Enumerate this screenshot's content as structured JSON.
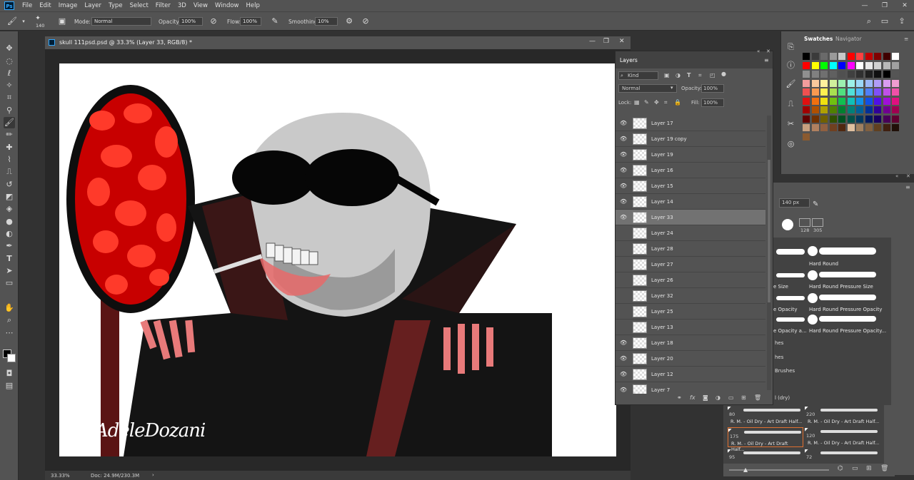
{
  "menu": {
    "logo": "Ps",
    "items": [
      "File",
      "Edit",
      "Image",
      "Layer",
      "Type",
      "Select",
      "Filter",
      "3D",
      "View",
      "Window",
      "Help"
    ]
  },
  "options": {
    "brush_size": "140",
    "mode_label": "Mode:",
    "mode_value": "Normal",
    "opacity_label": "Opacity:",
    "opacity_value": "100%",
    "flow_label": "Flow:",
    "flow_value": "100%",
    "smoothing_label": "Smoothing:",
    "smoothing_value": "10%"
  },
  "document": {
    "title": "skull 111psd.psd @ 33.3% (Layer 33, RGB/8) *",
    "zoom": "33.33%",
    "doc_size": "Doc: 24.9M/230.3M",
    "signature": "AdeleDozani"
  },
  "swatches": {
    "tab_active": "Swatches",
    "tab_other": "Navigator",
    "colors": [
      [
        "#000000",
        "#3a3a3a",
        "#6a6a6a",
        "#9a9a9a",
        "#c8c8c8",
        "#ff0000",
        "#ff4040",
        "#c00000",
        "#800000",
        "#400000",
        "#ffffff"
      ],
      [
        "#ff0000",
        "#ffff00",
        "#00ff00",
        "#00ffff",
        "#0000ff",
        "#ff00ff",
        "#ffffff",
        "#e8e8e8",
        "#d0d0d0",
        "#b8b8b8",
        "#a0a0a0"
      ],
      [
        "#909090",
        "#808080",
        "#707070",
        "#606060",
        "#505050",
        "#404040",
        "#303030",
        "#202020",
        "#101010",
        "#000000",
        "#555555"
      ],
      [
        "#f29c9c",
        "#f8c89c",
        "#fff09c",
        "#d0f09c",
        "#9cf0b0",
        "#9cf0e8",
        "#9cd8f8",
        "#9cb8f8",
        "#b09cf8",
        "#d89cf0",
        "#f09cd0"
      ],
      [
        "#ee5050",
        "#f89a50",
        "#fff050",
        "#a8e050",
        "#50e080",
        "#50e0d8",
        "#50b8f8",
        "#5080f8",
        "#8050f8",
        "#c050e8",
        "#f050a8"
      ],
      [
        "#e01010",
        "#f07010",
        "#f0e010",
        "#70c010",
        "#10c050",
        "#10c0b8",
        "#1090e8",
        "#1050e8",
        "#5010e8",
        "#a010d8",
        "#e01080"
      ],
      [
        "#a00000",
        "#b05000",
        "#b0a000",
        "#508000",
        "#008030",
        "#008078",
        "#006098",
        "#003098",
        "#300098",
        "#700090",
        "#a00050"
      ],
      [
        "#600000",
        "#703000",
        "#706000",
        "#305000",
        "#005020",
        "#005048",
        "#003860",
        "#001860",
        "#180060",
        "#480058",
        "#600030"
      ],
      [
        "#c8a080",
        "#b08060",
        "#906040",
        "#704020",
        "#502810",
        "#e0c0a0",
        "#a08060",
        "#806040",
        "#604020",
        "#402010",
        "#201008"
      ],
      [
        "#8a5a30"
      ]
    ]
  },
  "layers": {
    "panel_title": "Layers",
    "kind_label": "Kind",
    "blend_mode": "Normal",
    "opacity_label": "Opacity:",
    "opacity_value": "100%",
    "lock_label": "Lock:",
    "fill_label": "Fill:",
    "fill_value": "100%",
    "items": [
      {
        "name": "Layer 17",
        "visible": true,
        "selected": false
      },
      {
        "name": "Layer 19 copy",
        "visible": true,
        "selected": false
      },
      {
        "name": "Layer 19",
        "visible": true,
        "selected": false
      },
      {
        "name": "Layer 16",
        "visible": true,
        "selected": false
      },
      {
        "name": "Layer 15",
        "visible": true,
        "selected": false
      },
      {
        "name": "Layer 14",
        "visible": true,
        "selected": false
      },
      {
        "name": "Layer 33",
        "visible": true,
        "selected": true
      },
      {
        "name": "Layer 24",
        "visible": false,
        "selected": false
      },
      {
        "name": "Layer 28",
        "visible": false,
        "selected": false
      },
      {
        "name": "Layer 27",
        "visible": false,
        "selected": false
      },
      {
        "name": "Layer 26",
        "visible": false,
        "selected": false
      },
      {
        "name": "Layer 32",
        "visible": false,
        "selected": false
      },
      {
        "name": "Layer 25",
        "visible": false,
        "selected": false
      },
      {
        "name": "Layer 13",
        "visible": false,
        "selected": false
      },
      {
        "name": "Layer 18",
        "visible": true,
        "selected": false
      },
      {
        "name": "Layer 20",
        "visible": true,
        "selected": false
      },
      {
        "name": "Layer 12",
        "visible": true,
        "selected": false
      },
      {
        "name": "Layer 7",
        "visible": true,
        "selected": false
      }
    ]
  },
  "brushes": {
    "size": "140 px",
    "preset_values": [
      "128",
      "305"
    ],
    "list": [
      {
        "left": "",
        "right": "Hard Round"
      },
      {
        "left": "e Size",
        "right": "Hard Round Pressure Size"
      },
      {
        "left": "e Opacity",
        "right": "Hard Round Pressure Opacity"
      },
      {
        "left": "e Opacity a...",
        "right": "Hard Round Pressure Opacity..."
      }
    ],
    "groups": [
      "hes",
      "hes",
      "Brushes",
      "l (dry)"
    ],
    "presets": [
      {
        "num": "80",
        "label": "R. M. - Oil Dry - Art Draft Half..."
      },
      {
        "num": "220",
        "label": "R. M. - Oil Dry - Art Draft Half..."
      },
      {
        "num": "175",
        "label": "R. M. - Oil Dry - Art Draft Half..."
      },
      {
        "num": "120",
        "label": "R. M. - Oil Dry - Art Draft Half..."
      },
      {
        "num": "95",
        "label": ""
      },
      {
        "num": "72",
        "label": ""
      }
    ]
  }
}
